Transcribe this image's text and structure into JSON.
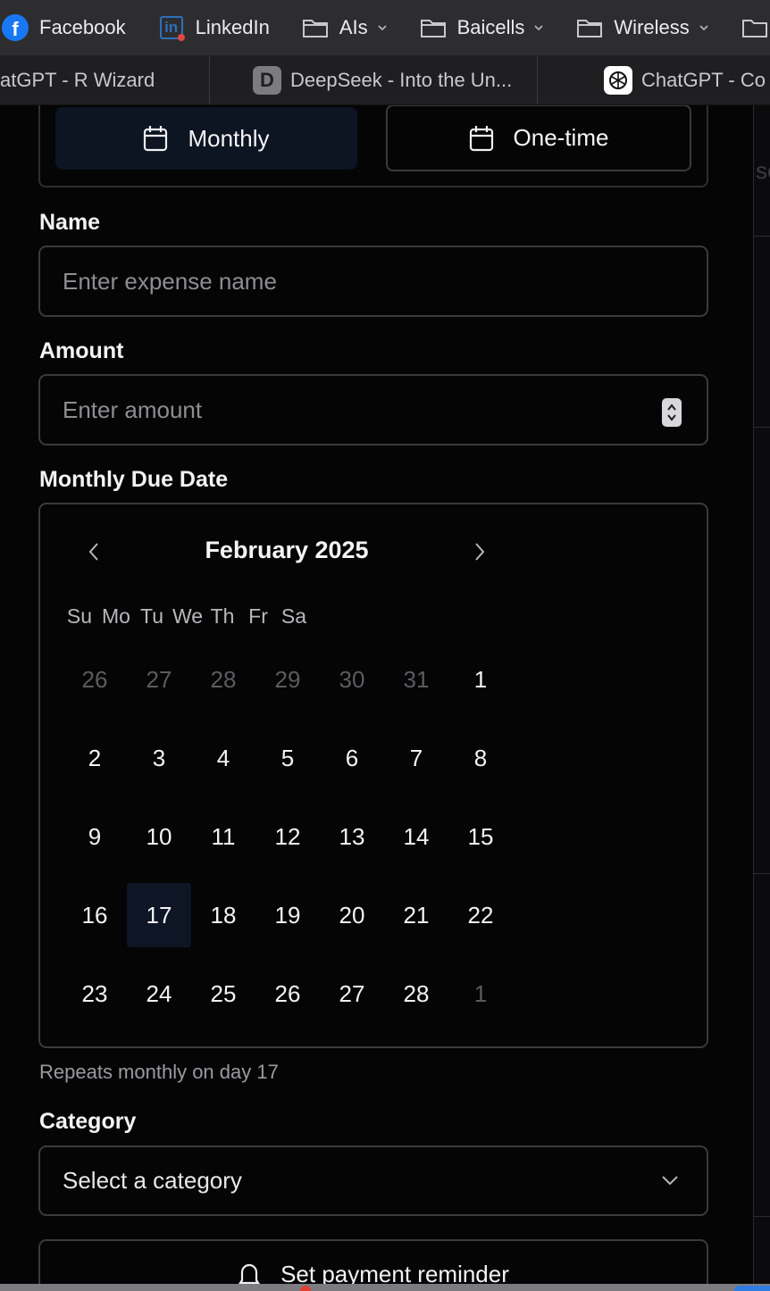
{
  "bookmarks": {
    "items": [
      {
        "label": "Facebook",
        "icon": "facebook-icon"
      },
      {
        "label": "LinkedIn",
        "icon": "linkedin-icon"
      },
      {
        "label": "AIs",
        "icon": "folder-icon"
      },
      {
        "label": "Baicells",
        "icon": "folder-icon"
      },
      {
        "label": "Wireless",
        "icon": "folder-icon"
      }
    ]
  },
  "tabs": {
    "items": [
      {
        "label": "atGPT - R Wizard"
      },
      {
        "label": "DeepSeek - Into the Un...",
        "icon_letter": "D"
      },
      {
        "label": "ChatGPT - Co"
      }
    ]
  },
  "form": {
    "type_toggle": {
      "monthly": "Monthly",
      "one_time": "One-time",
      "selected": "Monthly"
    },
    "name": {
      "label": "Name",
      "placeholder": "Enter expense name"
    },
    "amount": {
      "label": "Amount",
      "placeholder": "Enter amount"
    },
    "due_date": {
      "label": "Monthly Due Date"
    },
    "calendar": {
      "month_title": "February 2025",
      "weekdays": [
        "Su",
        "Mo",
        "Tu",
        "We",
        "Th",
        "Fr",
        "Sa"
      ],
      "weeks": [
        [
          26,
          27,
          28,
          29,
          30,
          31,
          1
        ],
        [
          2,
          3,
          4,
          5,
          6,
          7,
          8
        ],
        [
          9,
          10,
          11,
          12,
          13,
          14,
          15
        ],
        [
          16,
          17,
          18,
          19,
          20,
          21,
          22
        ],
        [
          23,
          24,
          25,
          26,
          27,
          28,
          1
        ]
      ],
      "selected_day": 17
    },
    "helper_text": "Repeats monthly on day 17",
    "category": {
      "label": "Category",
      "placeholder": "Select a category"
    },
    "reminder_button": "Set payment reminder"
  },
  "colors": {
    "background": "#050506",
    "selected_bg": "#0e1525",
    "border": "#3a3a3f",
    "muted_text": "#5b5b60"
  }
}
